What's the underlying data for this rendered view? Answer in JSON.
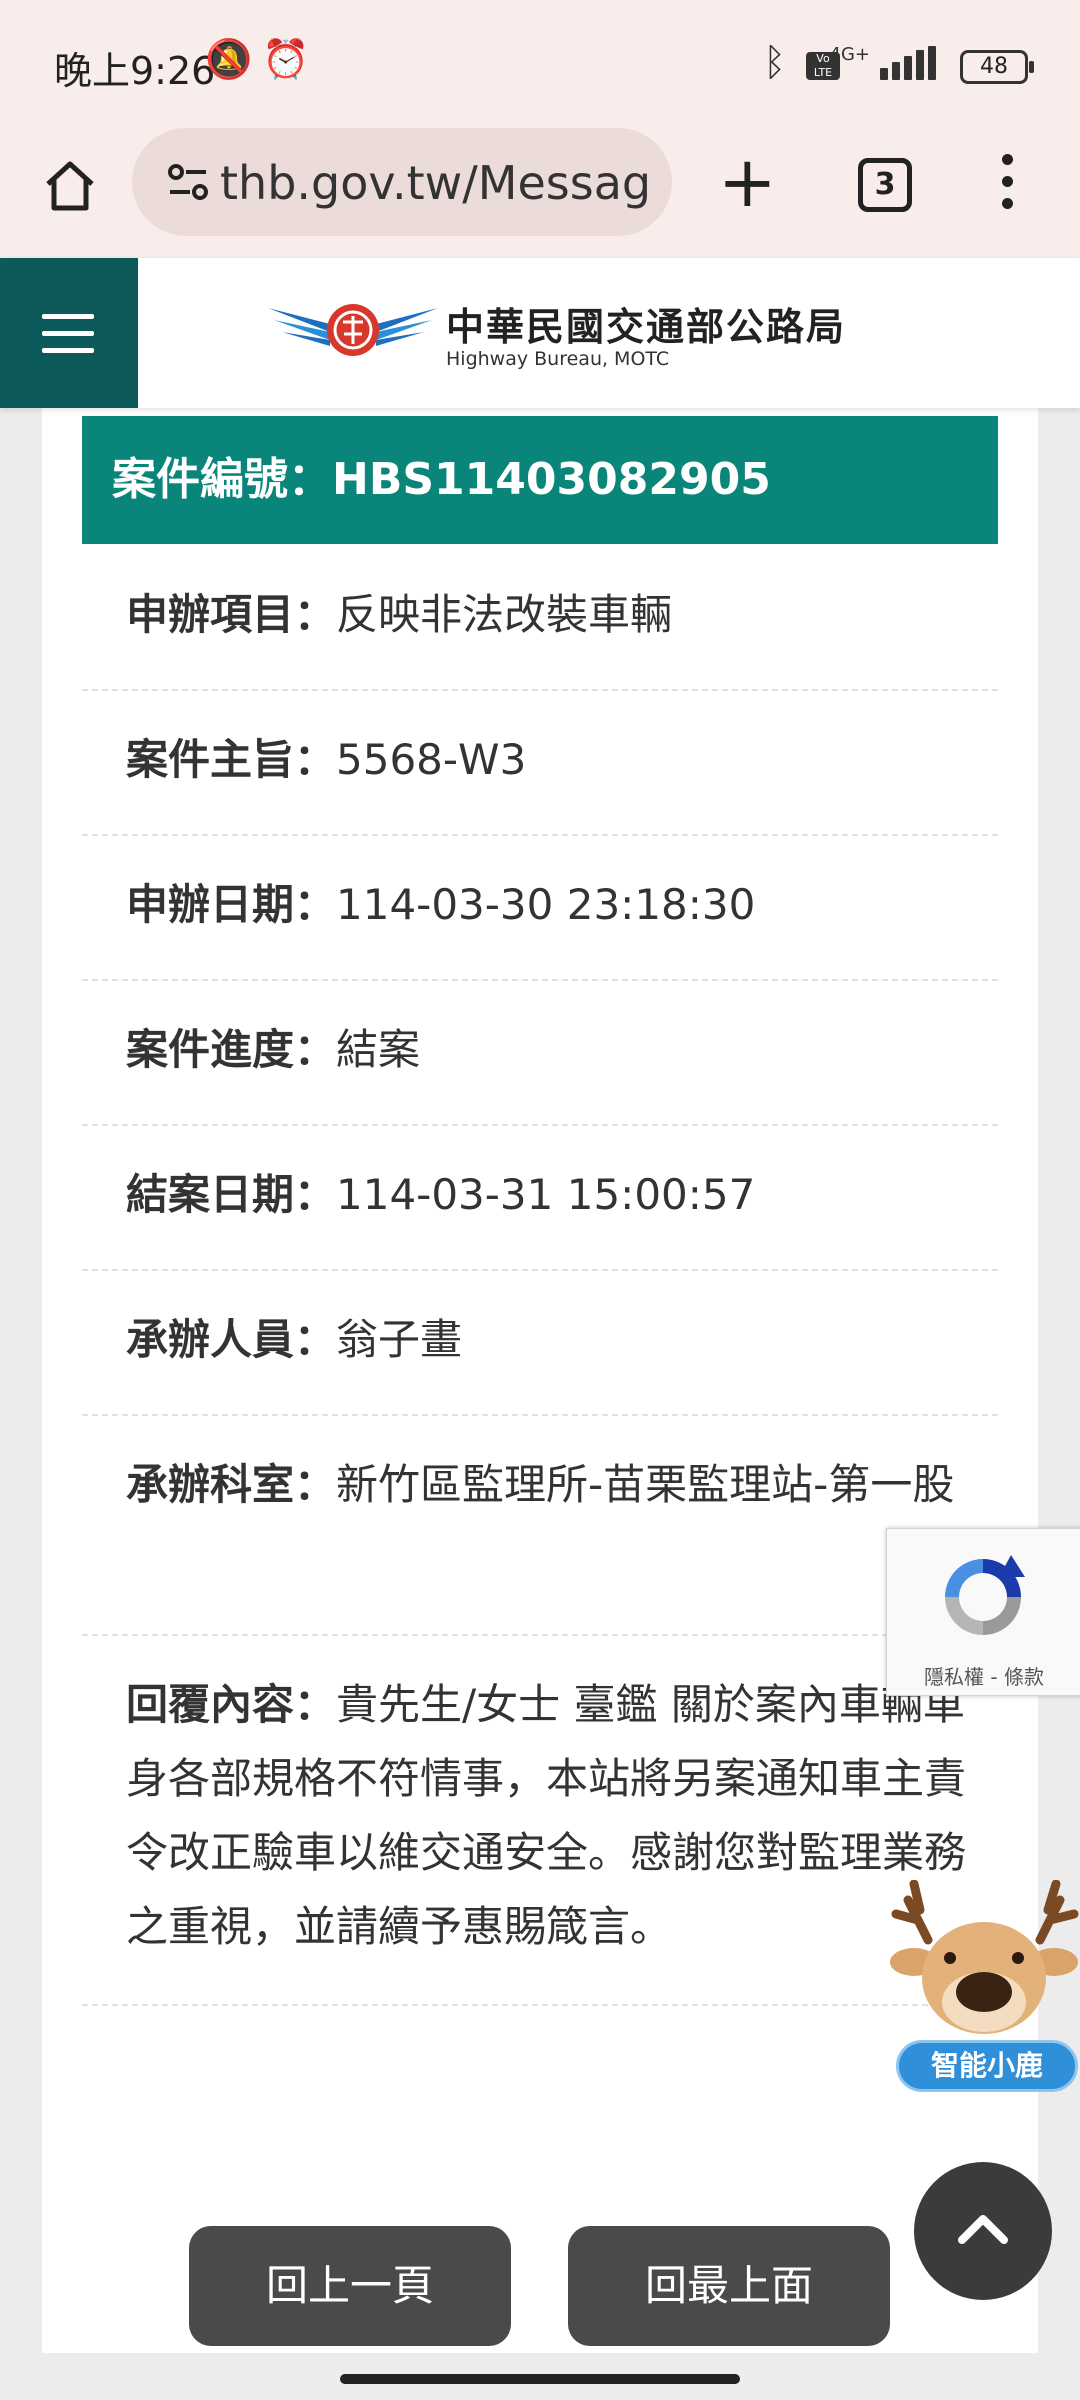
{
  "status_bar": {
    "time": "晚上9:26",
    "network": "4G+",
    "volte": "Vo LTE",
    "battery": "48",
    "icons": [
      "mute-icon",
      "alarm-icon",
      "bluetooth-icon",
      "signal-icon",
      "battery-icon"
    ]
  },
  "browser": {
    "url": "thb.gov.tw/MessageFe",
    "tab_count": "3",
    "icons": [
      "home-icon",
      "site-info-icon",
      "plus-icon",
      "menu-dots-icon"
    ]
  },
  "site": {
    "name_cn": "中華民國交通部公路局",
    "name_en": "Highway Bureau, MOTC"
  },
  "case": {
    "header": "案件編號：HBS11403082905",
    "rows": [
      {
        "label": "申辦項目：",
        "value": "反映非法改裝車輛"
      },
      {
        "label": "案件主旨：",
        "value": "5568-W3"
      },
      {
        "label": "申辦日期：",
        "value": "114-03-30 23:18:30"
      },
      {
        "label": "案件進度：",
        "value": "結案"
      },
      {
        "label": "結案日期：",
        "value": "114-03-31 15:00:57"
      },
      {
        "label": "承辦人員：",
        "value": "翁子畫"
      },
      {
        "label": "承辦科室：",
        "value": "新竹區監理所-苗栗監理站-第一股"
      },
      {
        "label": "回覆內容：",
        "value": "貴先生/女士 臺鑑 關於案內車輛車身各部規格不符情事，本站將另案通知車主責令改正驗車以維交通安全。感謝您對監理業務之重視，並請續予惠賜箴言。"
      }
    ]
  },
  "recaptcha": {
    "text": "隱私權 - 條款"
  },
  "assistant": {
    "label": "智能小鹿"
  },
  "buttons": {
    "back": "回上一頁",
    "top": "回最上面"
  }
}
